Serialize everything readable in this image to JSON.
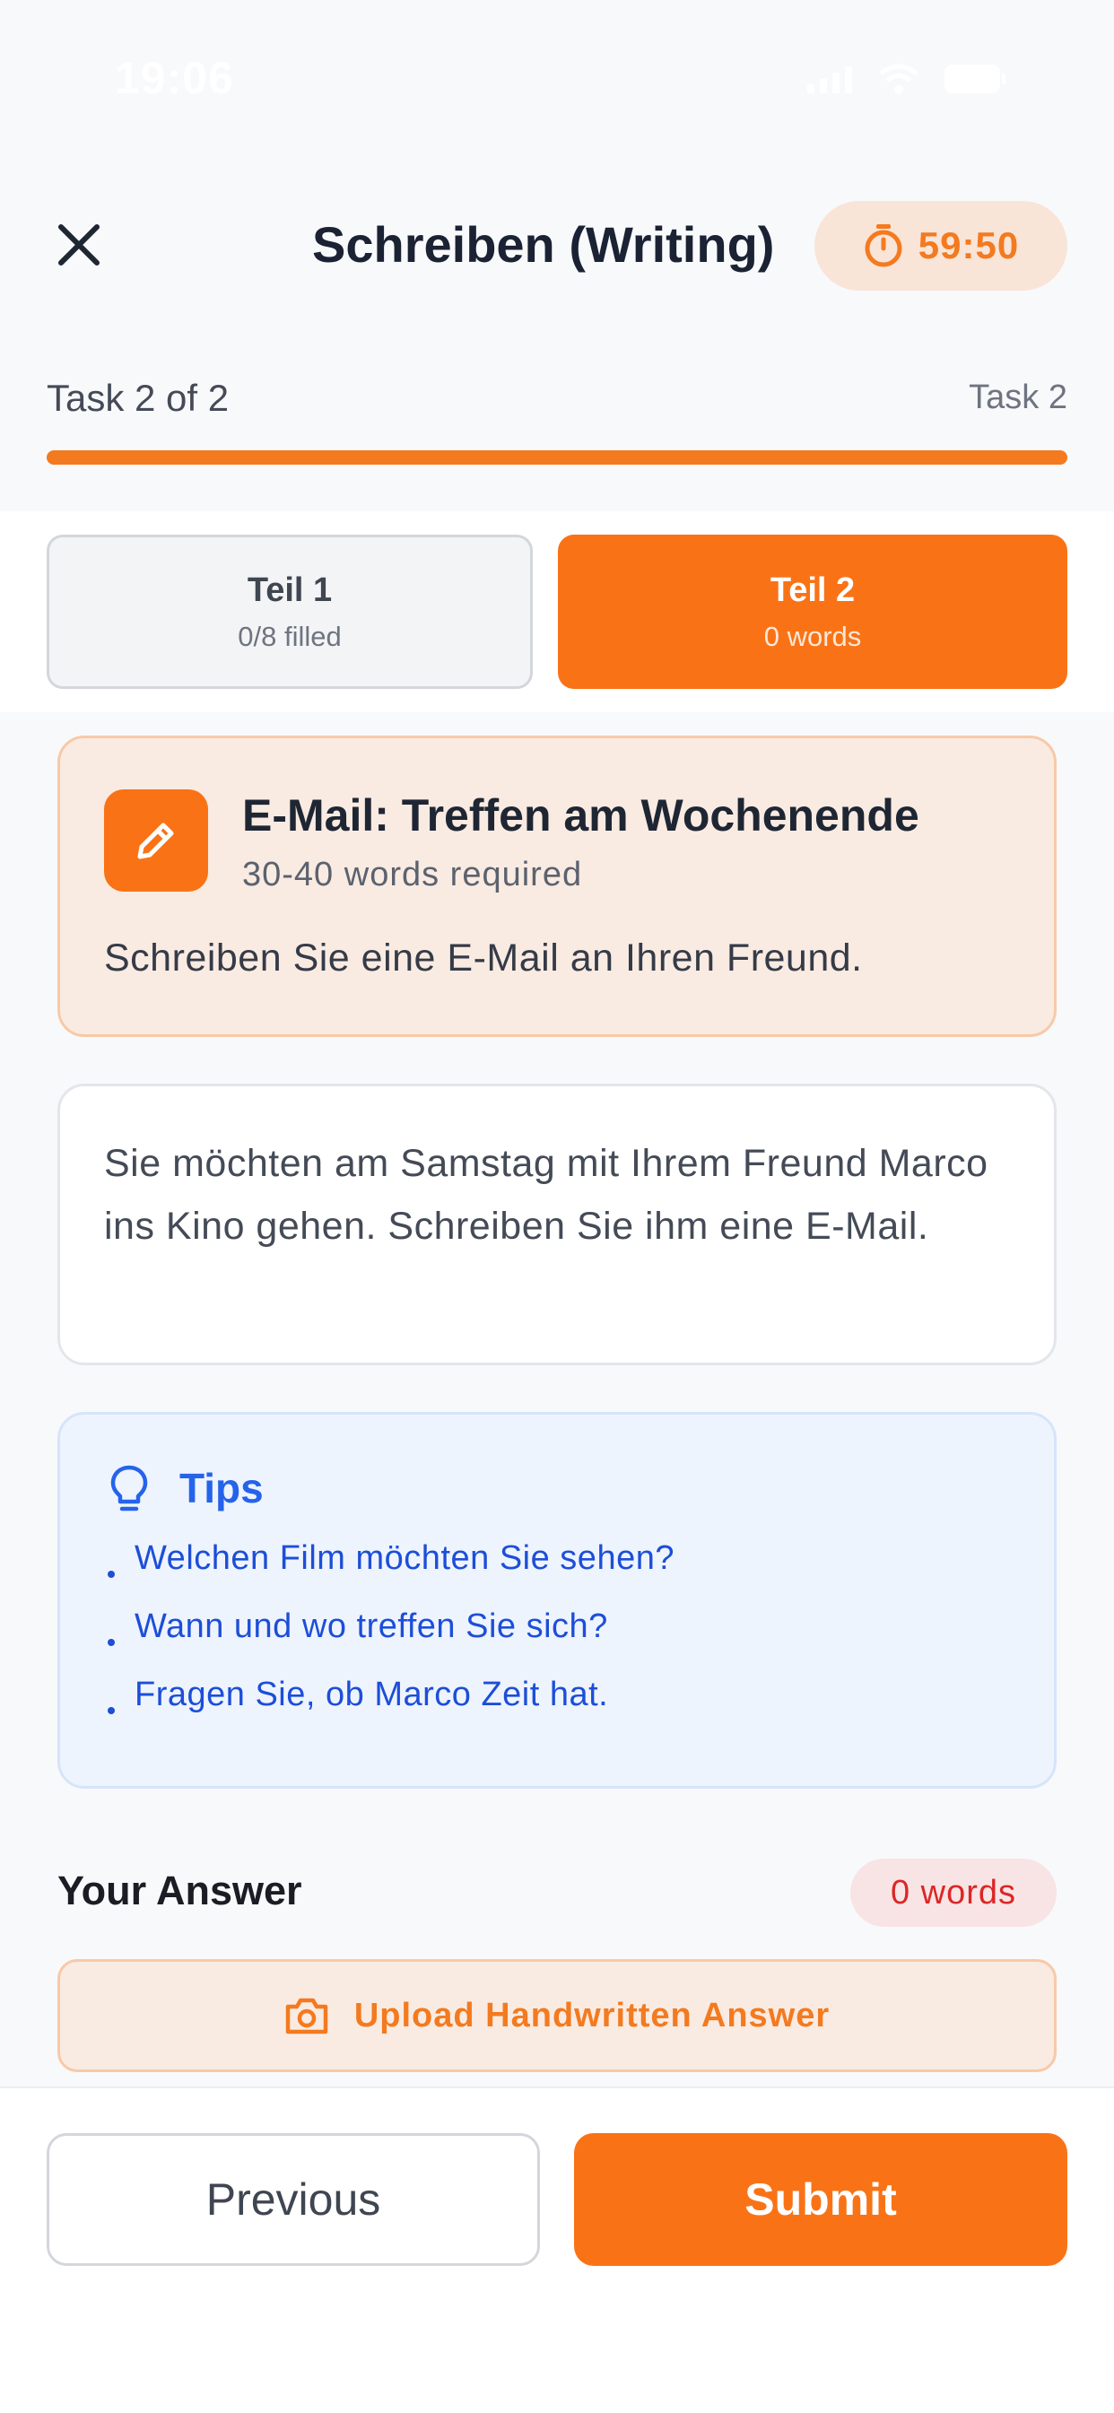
{
  "status_bar": {
    "time": "19:06"
  },
  "header": {
    "title": "Schreiben (Writing)",
    "timer": "59:50",
    "close_icon": "close-icon",
    "timer_icon": "stopwatch-icon"
  },
  "progress": {
    "label": "Task 2 of 2",
    "right_label": "Task 2",
    "fraction": 1.0
  },
  "tabs": [
    {
      "title": "Teil 1",
      "subtitle": "0/8 filled",
      "active": false
    },
    {
      "title": "Teil 2",
      "subtitle": "0 words",
      "active": true
    }
  ],
  "task": {
    "icon": "pencil-icon",
    "title": "E-Mail: Treffen am Wochenende",
    "requirement": "30-40 words required",
    "instruction": "Schreiben Sie eine E-Mail an Ihren Freund."
  },
  "scenario": {
    "text": "Sie möchten am Samstag mit Ihrem Freund Marco ins Kino gehen. Schreiben Sie ihm eine E-Mail."
  },
  "tips": {
    "icon": "lightbulb-icon",
    "title": "Tips",
    "items": [
      "Welchen Film möchten Sie sehen?",
      "Wann und wo treffen Sie sich?",
      "Fragen Sie, ob Marco Zeit hat."
    ]
  },
  "answer": {
    "label": "Your Answer",
    "word_count": "0 words",
    "upload_label": "Upload Handwritten Answer",
    "upload_icon": "camera-icon"
  },
  "footer": {
    "previous_label": "Previous",
    "submit_label": "Submit"
  },
  "colors": {
    "accent": "#f97316",
    "accent_text": "#f47a1f",
    "tips_blue": "#2563eb",
    "danger": "#dc2626"
  }
}
